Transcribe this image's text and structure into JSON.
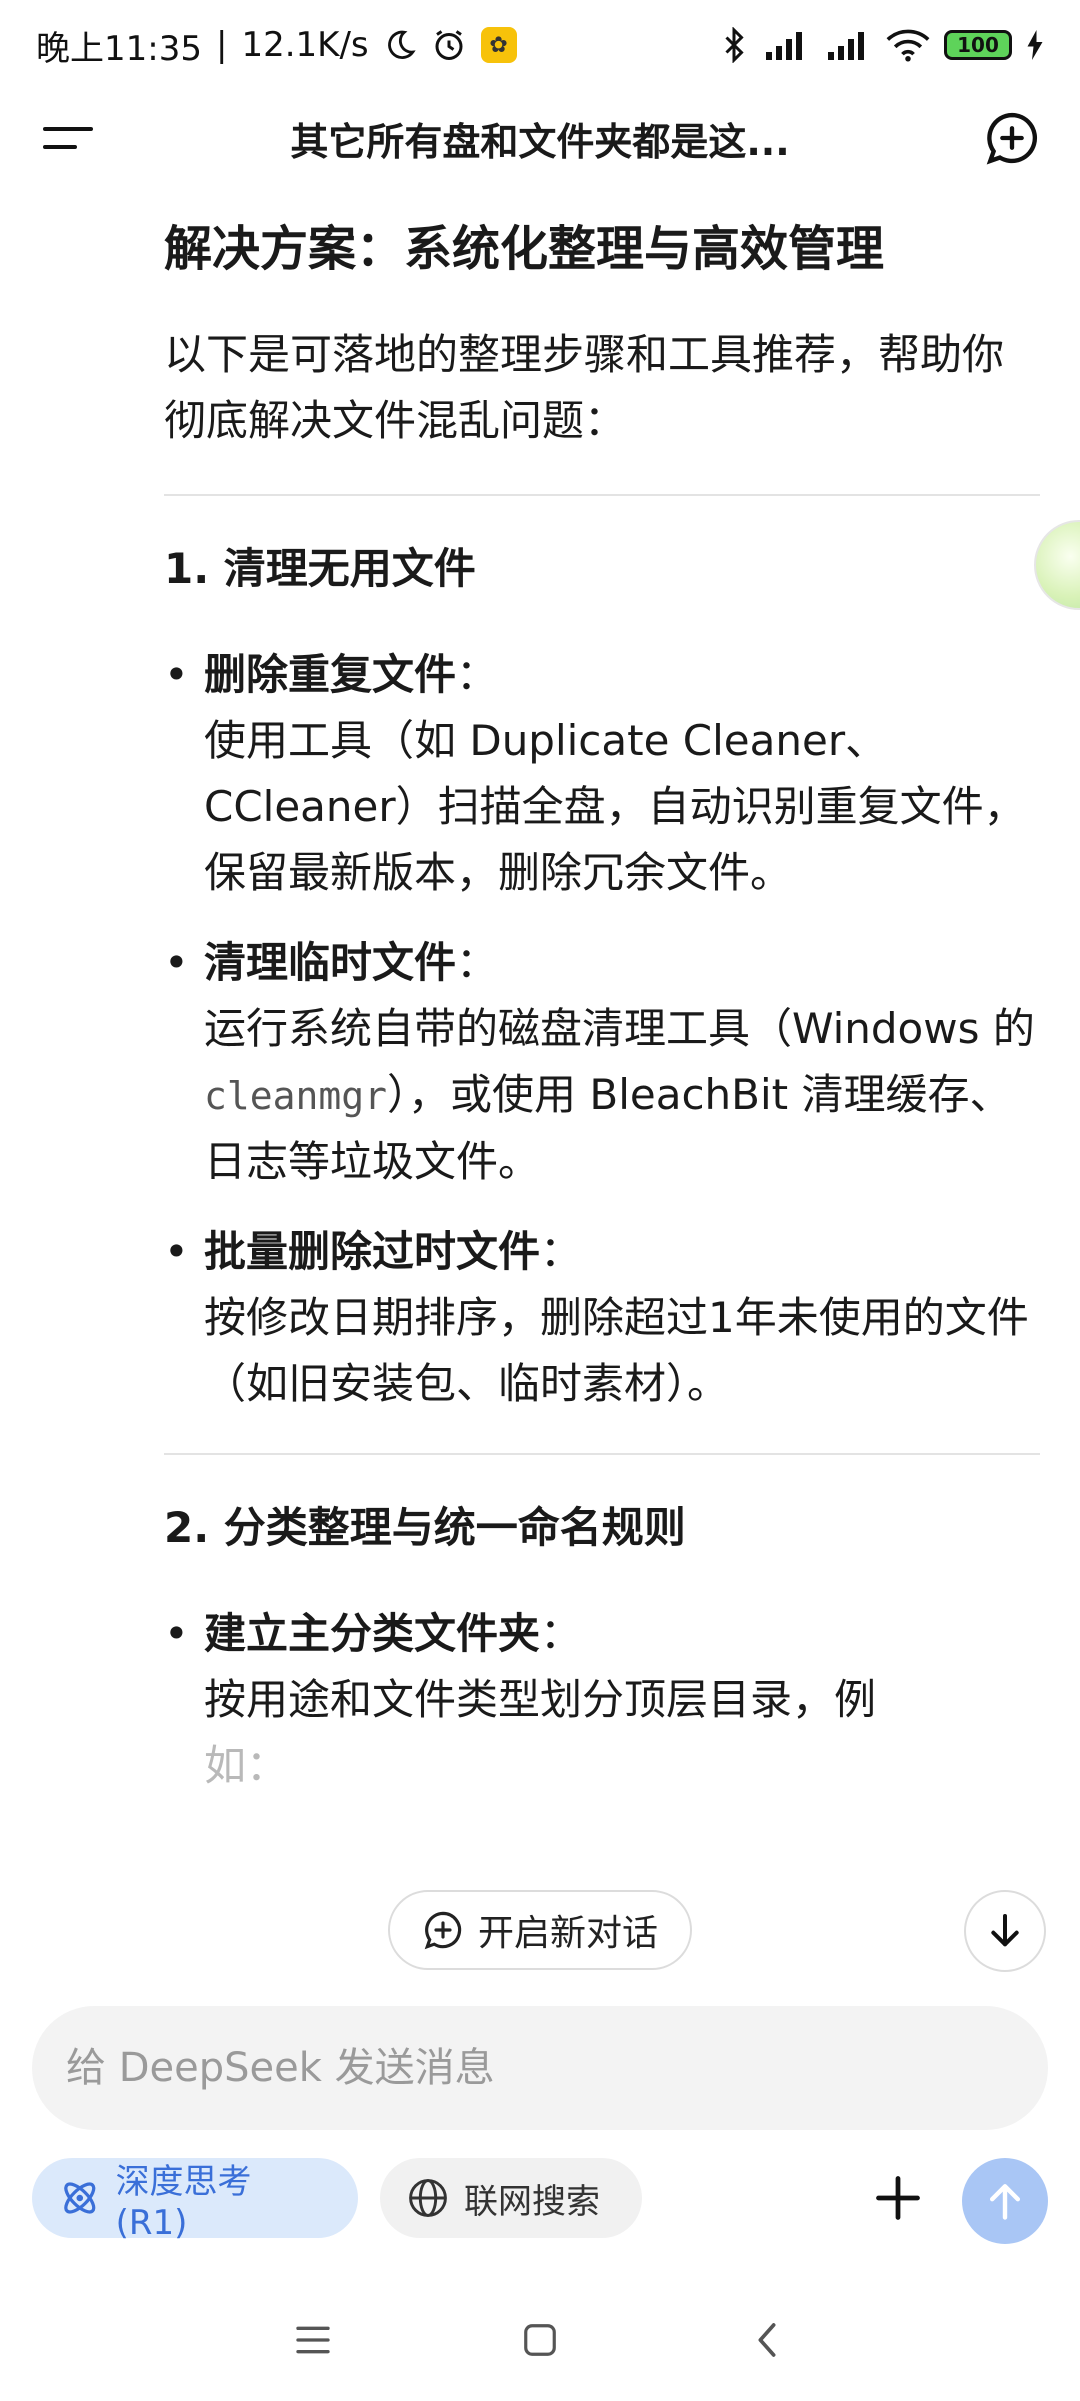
{
  "status": {
    "time": "晚上11:35",
    "separator": "|",
    "speed": "12.1K/s",
    "battery": "100"
  },
  "header": {
    "title": "其它所有盘和文件夹都是这..."
  },
  "content": {
    "heading": "解决方案：系统化整理与高效管理",
    "intro": "以下是可落地的整理步骤和工具推荐，帮助你彻底解决文件混乱问题：",
    "section1": {
      "title": "1. 清理无用文件",
      "bullets": [
        {
          "title": "删除重复文件",
          "colon": "：",
          "text": "使用工具（如 Duplicate Cleaner、CCleaner）扫描全盘，自动识别重复文件，保留最新版本，删除冗余文件。"
        },
        {
          "title": "清理临时文件",
          "colon": "：",
          "text_a": "运行系统自带的磁盘清理工具（Windows 的 ",
          "code": "cleanmgr",
          "text_b": "），或使用 BleachBit 清理缓存、日志等垃圾文件。"
        },
        {
          "title": "批量删除过时文件",
          "colon": "：",
          "text": "按修改日期排序，删除超过1年未使用的文件（如旧安装包、临时素材）。"
        }
      ]
    },
    "section2": {
      "title": "2. 分类整理与统一命名规则",
      "bullets": [
        {
          "title": "建立主分类文件夹",
          "colon": "：",
          "text": "按用途和文件类型划分顶层目录，例",
          "text_fade": "如："
        }
      ]
    }
  },
  "floating": {
    "new_dialog": "开启新对话"
  },
  "input": {
    "placeholder": "给 DeepSeek 发送消息"
  },
  "controls": {
    "deep_think": "深度思考 (R1)",
    "web_search": "联网搜索"
  },
  "colors": {
    "accent": "#3a6fd8",
    "chip_bg": "#dbe9fb",
    "send_bg": "#a9c6f5"
  }
}
